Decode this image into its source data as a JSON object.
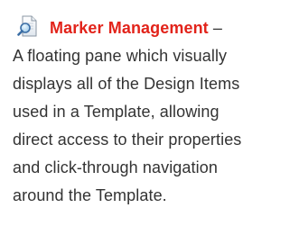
{
  "entry": {
    "icon": "marker-management-icon",
    "title": "Marker Management",
    "separator": " –",
    "description_lines": [
      "A floating pane which visually",
      "displays all of the Design Items",
      "used in a Template, allowing",
      "direct access to their properties",
      "and click-through navigation",
      "around the Template."
    ]
  },
  "colors": {
    "title": "#e2231a",
    "body_text": "#333333"
  }
}
